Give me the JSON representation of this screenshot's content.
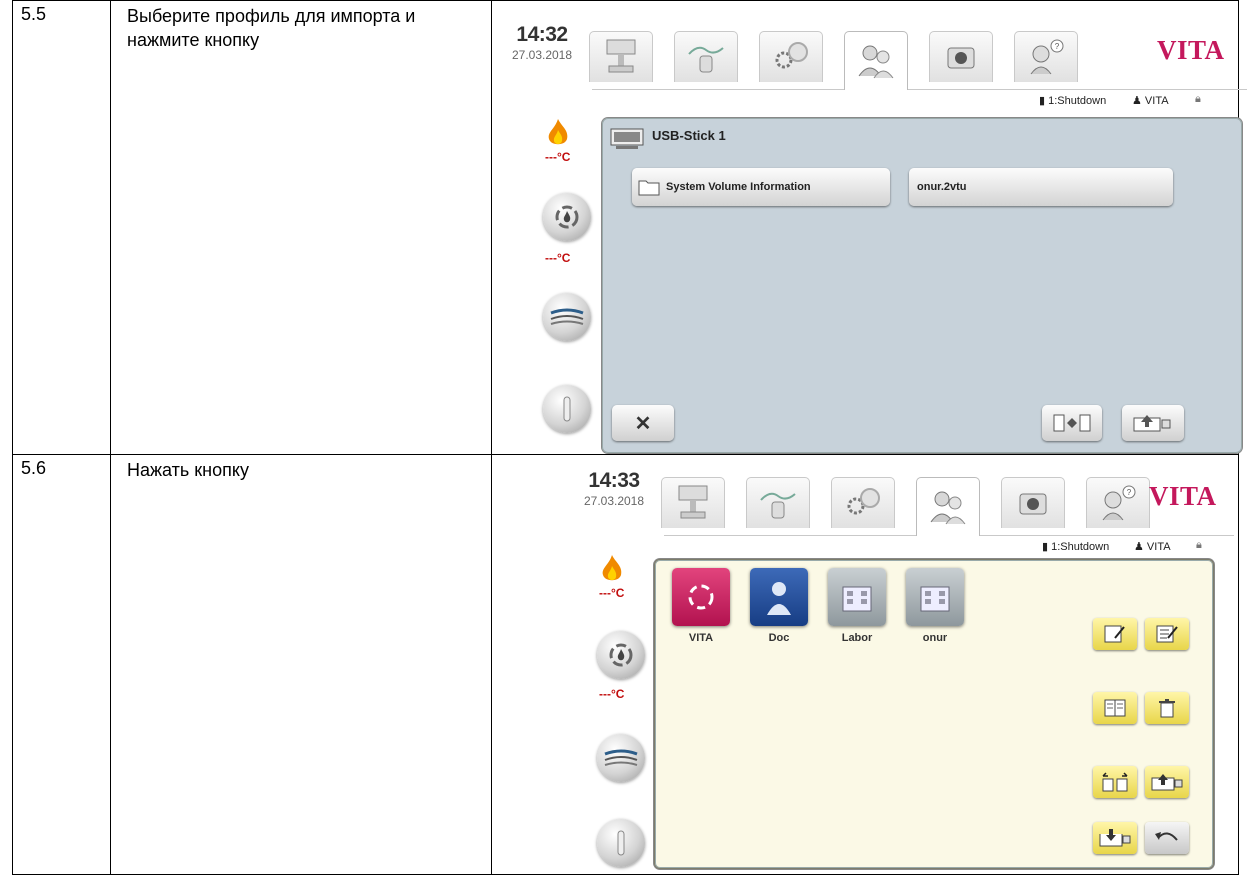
{
  "rows": [
    {
      "number": "5.5",
      "instruction": "Выберите профиль для импорта и нажмите кнопку",
      "screen": {
        "time": "14:32",
        "date": "27.03.2018",
        "logo": "VITA",
        "status_shutdown": "1:Shutdown",
        "status_user": "VITA",
        "temp_top": "---°C",
        "temp_mid": "---°C",
        "device_name": "USB-Stick 1",
        "files": [
          "System Volume Information",
          "onur.2vtu"
        ]
      }
    },
    {
      "number": "5.6",
      "instruction": "Нажать кнопку",
      "screen": {
        "time": "14:33",
        "date": "27.03.2018",
        "logo": "VITA",
        "status_shutdown": "1:Shutdown",
        "status_user": "VITA",
        "temp_top": "---°C",
        "temp_mid": "---°C",
        "profiles": [
          "VITA",
          "Doc",
          "Labor",
          "onur"
        ]
      }
    }
  ],
  "colors": {
    "brand": "#c4185c",
    "temp": "#c20e0e",
    "panel_blue": "#c7d2da",
    "panel_yellow": "#fbf9e6"
  },
  "icons": {
    "tabs": [
      "furnace-tab-icon",
      "program-curve-tab-icon",
      "settings-gears-tab-icon",
      "users-tab-icon",
      "camera-tab-icon",
      "help-tab-icon"
    ],
    "side": [
      "flame-icon",
      "cooling-icon",
      "vacuum-icon",
      "power-icon"
    ]
  }
}
